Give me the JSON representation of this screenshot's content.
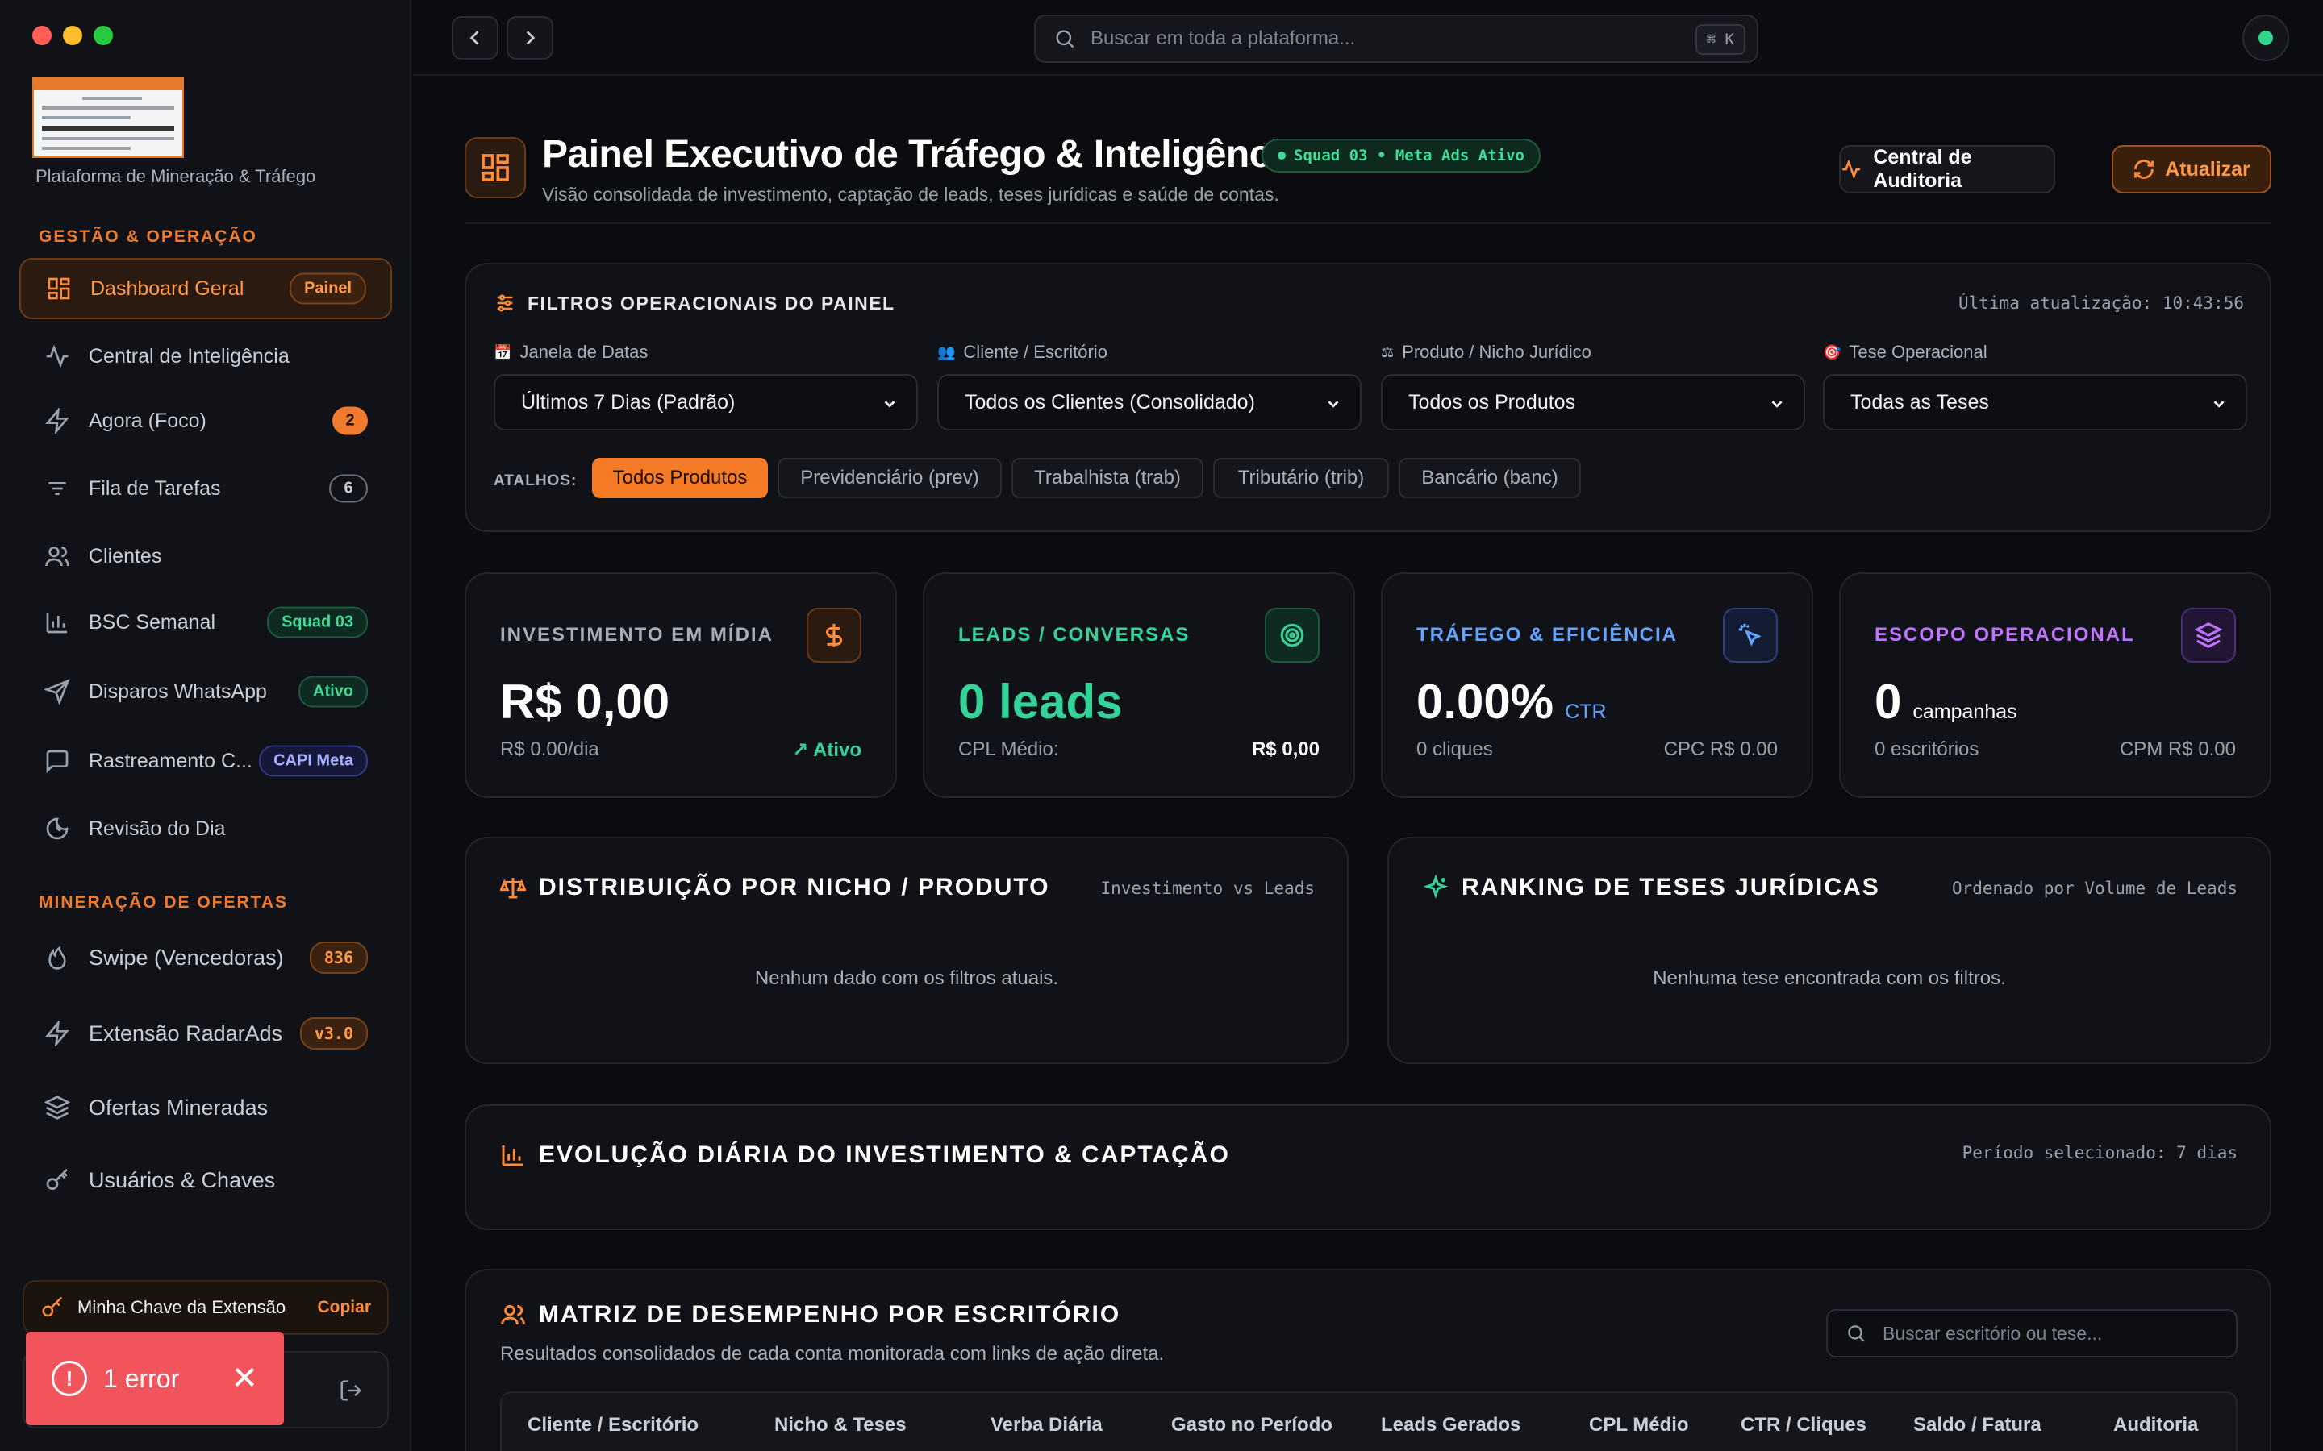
{
  "sidebar": {
    "brand_subtitle": "Plataforma de Mineração & Tráfego",
    "section_gestao": "GESTÃO & OPERAÇÃO",
    "section_mineracao": "MINERAÇÃO DE OFERTAS",
    "items": [
      {
        "label": "Dashboard Geral",
        "badge": "Painel",
        "icon": "dashboard-grid-icon"
      },
      {
        "label": "Central de Inteligência",
        "badge": "",
        "icon": "activity-icon"
      },
      {
        "label": "Agora (Foco)",
        "badge": "2",
        "icon": "bolt-icon"
      },
      {
        "label": "Fila de Tarefas",
        "badge": "6",
        "icon": "filter-lines-icon"
      },
      {
        "label": "Clientes",
        "badge": "",
        "icon": "users-icon"
      },
      {
        "label": "BSC Semanal",
        "badge": "Squad 03",
        "icon": "bar-chart-icon"
      },
      {
        "label": "Disparos WhatsApp",
        "badge": "Ativo",
        "icon": "send-icon"
      },
      {
        "label": "Rastreamento C...",
        "badge": "CAPI Meta",
        "icon": "message-square-icon"
      },
      {
        "label": "Revisão do Dia",
        "badge": "",
        "icon": "moon-clock-icon"
      },
      {
        "label": "Swipe (Vencedoras)",
        "badge": "836",
        "icon": "flame-icon"
      },
      {
        "label": "Extensão RadarAds",
        "badge": "v3.0",
        "icon": "bolt-icon"
      },
      {
        "label": "Ofertas Mineradas",
        "badge": "",
        "icon": "layers-icon"
      },
      {
        "label": "Usuários & Chaves",
        "badge": "",
        "icon": "key-icon"
      }
    ],
    "extension_key_label": "Minha Chave da Extensão",
    "extension_key_copy": "Copiar"
  },
  "toast": {
    "error_label": "1 error"
  },
  "topbar": {
    "search_placeholder": "Buscar em toda a plataforma...",
    "shortcut": "⌘ K"
  },
  "header": {
    "title": "Painel Executivo de Tráfego & Inteligência",
    "pill": "Squad 03 • Meta Ads Ativo",
    "subtitle": "Visão consolidada de investimento, captação de leads, teses jurídicas e saúde de contas.",
    "audit_button": "Central de Auditoria",
    "refresh_button": "Atualizar"
  },
  "filters": {
    "title": "FILTROS OPERACIONAIS DO PAINEL",
    "last_update": "Última atualização: 10:43:56",
    "date_label": "Janela de Datas",
    "date_value": "Últimos 7 Dias (Padrão)",
    "client_label": "Cliente / Escritório",
    "client_value": "Todos os Clientes (Consolidado)",
    "product_label": "Produto / Nicho Jurídico",
    "product_value": "Todos os Produtos",
    "thesis_label": "Tese Operacional",
    "thesis_value": "Todas as Teses",
    "shortcuts_label": "ATALHOS:",
    "chips": [
      "Todos Produtos",
      "Previdenciário (prev)",
      "Trabalhista (trab)",
      "Tributário (trib)",
      "Bancário (banc)"
    ]
  },
  "kpis": {
    "investimento": {
      "label": "INVESTIMENTO EM MÍDIA",
      "value": "R$ 0,00",
      "foot_left": "R$ 0.00/dia",
      "foot_right": "Ativo",
      "color": "#a7adb8"
    },
    "leads": {
      "label": "LEADS / CONVERSAS",
      "value": "0 leads",
      "foot_left": "CPL Médio:",
      "foot_right": "R$ 0,00",
      "color": "#35d399"
    },
    "trafego": {
      "label": "TRÁFEGO & EFICIÊNCIA",
      "value": "0.00%",
      "unit": "CTR",
      "foot_left": "0 cliques",
      "foot_right": "CPC R$ 0.00",
      "color": "#62a4ff"
    },
    "escopo": {
      "label": "ESCOPO OPERACIONAL",
      "value": "0",
      "unit": "campanhas",
      "foot_left": "0 escritórios",
      "foot_right": "CPM R$ 0.00",
      "color": "#c074ff"
    }
  },
  "panels": {
    "nicho": {
      "title": "DISTRIBUIÇÃO POR NICHO / PRODUTO",
      "note": "Investimento vs Leads",
      "empty": "Nenhum dado com os filtros atuais."
    },
    "ranking": {
      "title": "RANKING DE TESES JURÍDICAS",
      "note": "Ordenado por Volume de Leads",
      "empty": "Nenhuma tese encontrada com os filtros."
    },
    "evolucao": {
      "title": "EVOLUÇÃO DIÁRIA DO INVESTIMENTO & CAPTAÇÃO",
      "note": "Período selecionado: 7 dias"
    }
  },
  "matrix": {
    "title": "MATRIZ DE DESEMPENHO POR ESCRITÓRIO",
    "subtitle": "Resultados consolidados de cada conta monitorada com links de ação direta.",
    "search_placeholder": "Buscar escritório ou tese...",
    "columns": [
      "Cliente / Escritório",
      "Nicho & Teses",
      "Verba Diária",
      "Gasto no Período",
      "Leads Gerados",
      "CPL Médio",
      "CTR / Cliques",
      "Saldo / Fatura",
      "Auditoria"
    ]
  },
  "colors": {
    "accent": "#ff8c3a",
    "success": "#35d399",
    "error": "#f2545b"
  }
}
